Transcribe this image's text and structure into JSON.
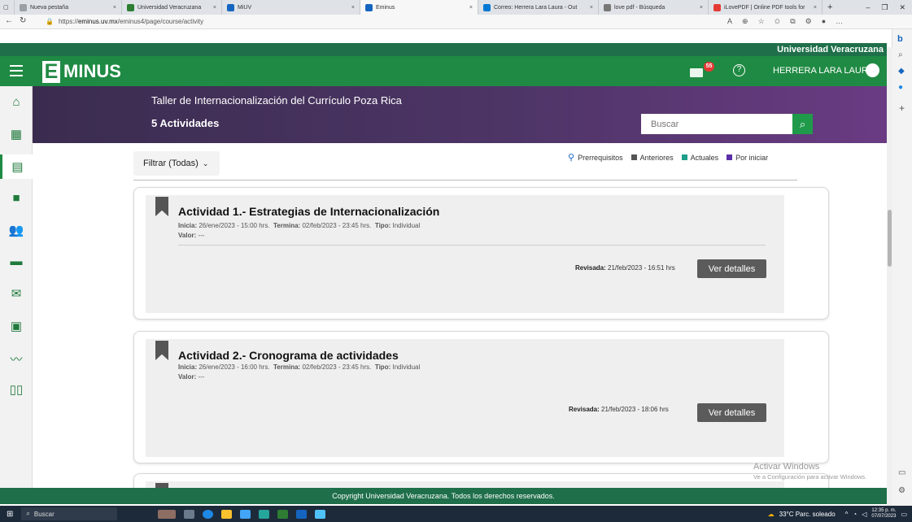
{
  "browser": {
    "tabs": [
      {
        "label": "Nueva pestaña",
        "color": "#9aa0a6"
      },
      {
        "label": "Universidad Veracruzana",
        "color": "#2e7d32"
      },
      {
        "label": "MiUV",
        "color": "#1565c0"
      },
      {
        "label": "Eminus",
        "color": "#1565c0"
      },
      {
        "label": "Correo: Herrera Lara Laura - Out",
        "color": "#0078d4"
      },
      {
        "label": "love pdf - Búsqueda",
        "color": "#777777"
      },
      {
        "label": "iLovePDF | Online PDF tools for",
        "color": "#e53935"
      }
    ],
    "url_prefix": "https://",
    "url_domain": "eminus.uv.mx",
    "url_path": "/eminus4/page/course/activity"
  },
  "header": {
    "university": "Universidad Veracruzana",
    "logo_text": "MINUS",
    "logo_letter": "E",
    "mail_badge": "55",
    "user_name": "HERRERA LARA LAURA"
  },
  "sidebar": {
    "icons": [
      "home-icon",
      "dashboard-icon",
      "activities-icon",
      "content-icon",
      "participants-icon",
      "forum-icon",
      "mail-icon",
      "broadcast-icon",
      "stats-icon",
      "book-icon"
    ]
  },
  "course": {
    "title": "Taller de Internacionalización del Currículo Poza Rica",
    "activity_count": "5 Actividades",
    "search_placeholder": "Buscar"
  },
  "filter": {
    "label": "Filtrar (Todas)",
    "legend": [
      {
        "label": "Prerrequisitos",
        "color": "#1565c0"
      },
      {
        "label": "Anteriores",
        "color": "#555555"
      },
      {
        "label": "Actuales",
        "color": "#1e9e8a"
      },
      {
        "label": "Por iniciar",
        "color": "#5b2ea6"
      }
    ]
  },
  "activities": [
    {
      "title": "Actividad 1.- Estrategias de Internacionalización",
      "inicia_label": "Inicia:",
      "inicia": "26/ene/2023 - 15:00 hrs.",
      "termina_label": "Termina:",
      "termina": "02/feb/2023 - 23:45 hrs.",
      "tipo_label": "Tipo:",
      "tipo": "Individual",
      "valor_label": "Valor:",
      "valor": "---",
      "revisada_label": "Revisada:",
      "revisada": "21/feb/2023 - 16:51 hrs",
      "button": "Ver detalles"
    },
    {
      "title": "Actividad 2.- Cronograma de actividades",
      "inicia_label": "Inicia:",
      "inicia": "26/ene/2023 - 16:00 hrs.",
      "termina_label": "Termina:",
      "termina": "02/feb/2023 - 23:45 hrs.",
      "tipo_label": "Tipo:",
      "tipo": "Individual",
      "valor_label": "Valor:",
      "valor": "---",
      "revisada_label": "Revisada:",
      "revisada": "21/feb/2023 - 18:06 hrs",
      "button": "Ver detalles"
    }
  ],
  "footer": "Copyright Universidad Veracruzana. Todos los derechos reservados.",
  "watermark": {
    "title": "Activar Windows",
    "subtitle": "Ve a Configuración para activar Windows."
  },
  "taskbar": {
    "search": "Buscar",
    "weather": "33°C  Parc. soleado",
    "time": "12:35 p. m.",
    "date": "07/07/2023"
  }
}
